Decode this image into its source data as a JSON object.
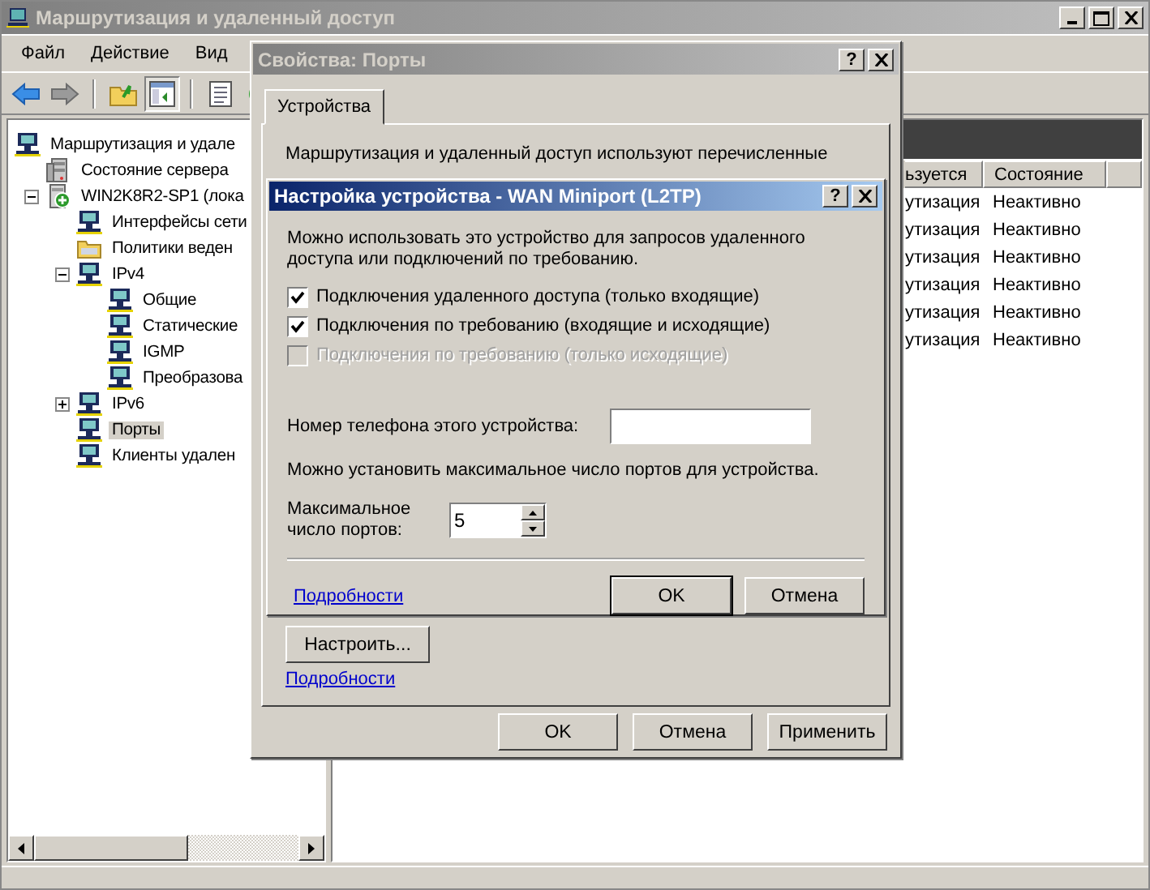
{
  "main_window": {
    "title": "Маршрутизация и удаленный доступ",
    "active": false
  },
  "menu": [
    "Файл",
    "Действие",
    "Вид"
  ],
  "tree": [
    {
      "label": "Маршрутизация и удале",
      "kind": "network",
      "selected": false,
      "children": [
        {
          "label": "Состояние сервера",
          "kind": "server",
          "selected": false
        },
        {
          "label": "WIN2K8R2-SP1 (лока",
          "kind": "host",
          "selected": false,
          "expanded": true,
          "children": [
            {
              "label": "Интерфейсы сети",
              "kind": "network",
              "selected": false
            },
            {
              "label": "Политики веден",
              "kind": "folder",
              "selected": false
            },
            {
              "label": "IPv4",
              "kind": "network",
              "selected": false,
              "expanded": true,
              "children": [
                {
                  "label": "Общие",
                  "kind": "network",
                  "selected": false
                },
                {
                  "label": "Статические",
                  "kind": "network",
                  "selected": false
                },
                {
                  "label": "IGMP",
                  "kind": "network",
                  "selected": false
                },
                {
                  "label": "Преобразова",
                  "kind": "network",
                  "selected": false
                }
              ]
            },
            {
              "label": "IPv6",
              "kind": "network",
              "selected": false,
              "expanded": false
            },
            {
              "label": "Порты",
              "kind": "network",
              "selected": true
            },
            {
              "label": "Клиенты удален",
              "kind": "network",
              "selected": false
            }
          ]
        }
      ]
    }
  ],
  "list": {
    "columns": [
      "ьзуется",
      "Состояние"
    ],
    "rows": [
      [
        "утизация",
        "Неактивно"
      ],
      [
        "утизация",
        "Неактивно"
      ],
      [
        "утизация",
        "Неактивно"
      ],
      [
        "утизация",
        "Неактивно"
      ],
      [
        "утизация",
        "Неактивно"
      ],
      [
        "утизация",
        "Неактивно"
      ]
    ]
  },
  "properties_dialog": {
    "title": "Свойства: Порты",
    "active": false,
    "help": "?",
    "tabs": [
      {
        "label": "Устройства",
        "selected": true
      }
    ],
    "description": "Маршрутизация и удаленный доступ используют перечисленные",
    "configure_button": "Настроить...",
    "details_link": "Подробности",
    "buttons": [
      {
        "label": "OK",
        "default": false
      },
      {
        "label": "Отмена",
        "default": false
      },
      {
        "label": "Применить",
        "default": false
      }
    ]
  },
  "device_dialog": {
    "title": "Настройка устройства - WAN Miniport (L2TP)",
    "active": true,
    "help": "?",
    "intro": "Можно использовать это устройство для запросов удаленного доступа или подключений по требованию.",
    "checkboxes": [
      {
        "label": "Подключения удаленного доступа (только входящие)",
        "checked": true,
        "disabled": false
      },
      {
        "label": "Подключения по требованию (входящие и исходящие)",
        "checked": true,
        "disabled": false
      },
      {
        "label": "Подключения по требованию (только исходящие)",
        "checked": false,
        "disabled": true
      }
    ],
    "phone_label": "Номер телефона этого устройства:",
    "ports_note": "Можно установить максимальное число портов для устройства.",
    "max_ports_label": "Максимальное число портов:",
    "max_ports_value": "5",
    "details_link": "Подробности",
    "buttons": [
      {
        "label": "OK",
        "default": true
      },
      {
        "label": "Отмена",
        "default": false
      }
    ]
  }
}
